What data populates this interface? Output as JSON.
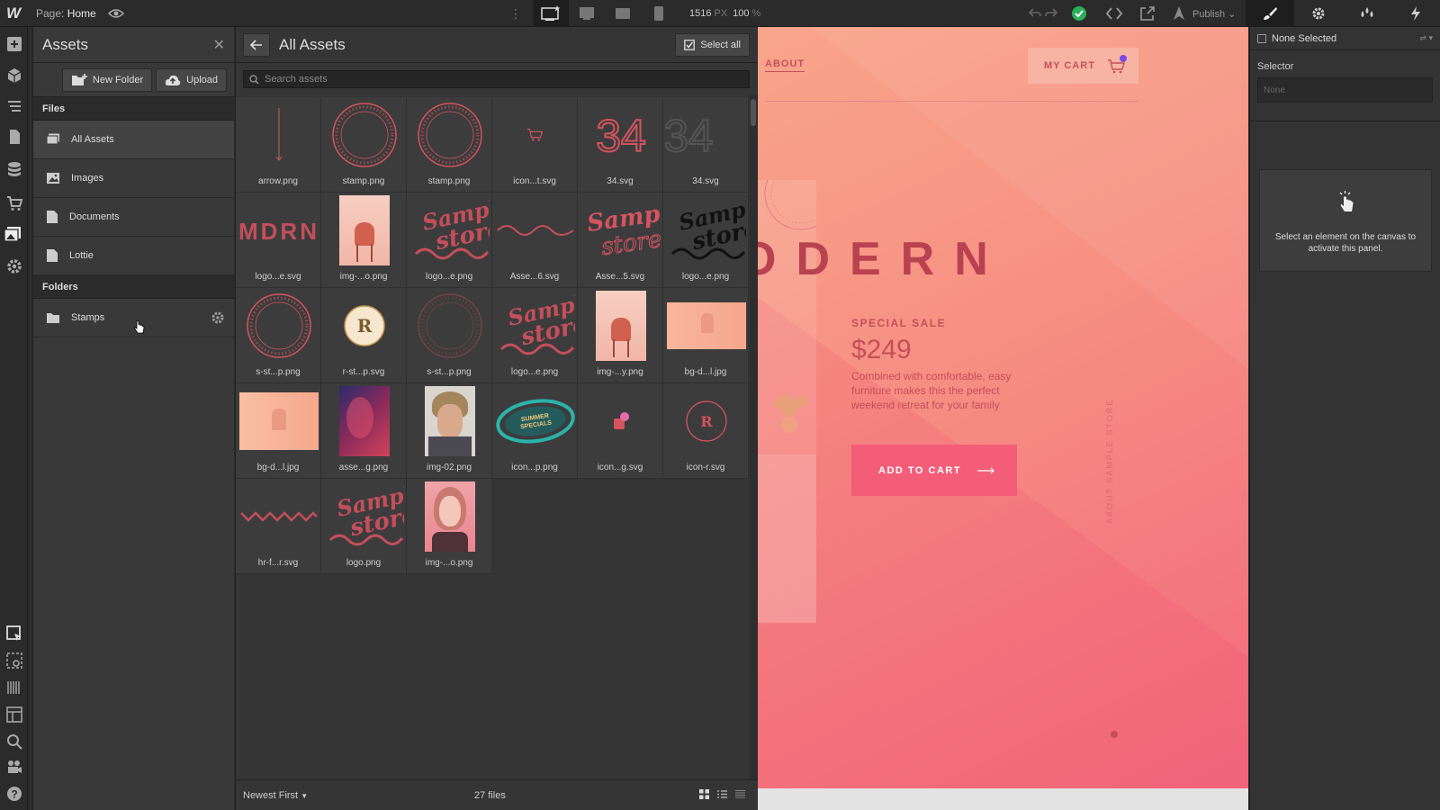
{
  "topbar": {
    "logo": "W",
    "page_label": "Page:",
    "page_name": "Home",
    "width_value": "1516",
    "width_unit": "PX",
    "zoom_value": "100",
    "zoom_unit": "%",
    "publish_label": "Publish"
  },
  "assets_panel": {
    "title": "Assets",
    "new_folder_label": "New Folder",
    "upload_label": "Upload",
    "files_section_label": "Files",
    "file_items": [
      {
        "label": "All Assets",
        "icon": "assets-icon",
        "active": true
      },
      {
        "label": "Images",
        "icon": "image-icon"
      },
      {
        "label": "Documents",
        "icon": "document-icon"
      },
      {
        "label": "Lottie",
        "icon": "document-icon"
      }
    ],
    "folders_section_label": "Folders",
    "folders": [
      {
        "label": "Stamps",
        "icon": "folder-icon"
      }
    ]
  },
  "asset_grid": {
    "title": "All Assets",
    "select_all_label": "Select all",
    "search_placeholder": "Search assets",
    "sort_label": "Newest First",
    "file_count": "27 files",
    "tiles": [
      {
        "label": "arrow.png",
        "kind": "arrow"
      },
      {
        "label": "stamp.png",
        "kind": "stamp"
      },
      {
        "label": "stamp.png",
        "kind": "stamp"
      },
      {
        "label": "icon...t.svg",
        "kind": "cart"
      },
      {
        "label": "34.svg",
        "kind": "num34",
        "thumb_text": "34"
      },
      {
        "label": "34.svg",
        "kind": "num34dim",
        "thumb_text": "34"
      },
      {
        "label": "logo...e.svg",
        "kind": "mdrn",
        "thumb_text": "MDRN"
      },
      {
        "label": "img-...o.png",
        "kind": "chair"
      },
      {
        "label": "logo...e.png",
        "kind": "sample",
        "thumb_text": "Sample store"
      },
      {
        "label": "Asse...6.svg",
        "kind": "wave"
      },
      {
        "label": "Asse...5.svg",
        "kind": "sample2",
        "thumb_text": "Sample store"
      },
      {
        "label": "logo...e.png",
        "kind": "sampleblack",
        "thumb_text": "Sample store"
      },
      {
        "label": "s-st...p.png",
        "kind": "stamp"
      },
      {
        "label": "r-st...p.svg",
        "kind": "rcircle",
        "thumb_text": "R"
      },
      {
        "label": "s-st...p.png",
        "kind": "stampdim"
      },
      {
        "label": "logo...e.png",
        "kind": "sample",
        "thumb_text": "Sample store"
      },
      {
        "label": "img-...y.png",
        "kind": "chair"
      },
      {
        "label": "bg-d...l.jpg",
        "kind": "bgwide"
      },
      {
        "label": "bg-d...l.jpg",
        "kind": "bg"
      },
      {
        "label": "asse...g.png",
        "kind": "face"
      },
      {
        "label": "img-02.png",
        "kind": "portrait"
      },
      {
        "label": "icon...p.png",
        "kind": "summer",
        "thumb_text": "SUMMER SPECIALS"
      },
      {
        "label": "icon...g.svg",
        "kind": "bag"
      },
      {
        "label": "icon-r.svg",
        "kind": "ricon",
        "thumb_text": "R"
      },
      {
        "label": "hr-f...r.svg",
        "kind": "zigzag"
      },
      {
        "label": "logo.png",
        "kind": "sample",
        "thumb_text": "Sample store"
      },
      {
        "label": "img-...o.png",
        "kind": "woman"
      }
    ]
  },
  "canvas": {
    "nav_about": "ABOUT",
    "cart_label": "MY CART",
    "heading": "ODERN",
    "special_sale": "SPECIAL SALE",
    "price": "$249",
    "description": "Combined with comfortable, easy furniture makes this the perfect weekend retreat for your family",
    "cta": "ADD TO CART",
    "vertical_text": "ABOUT SAMPLE STORE",
    "accent": "#f35d78",
    "text_color": "#c44f5b"
  },
  "right_panel": {
    "none_selected": "None Selected",
    "selector_label": "Selector",
    "selector_placeholder": "None",
    "empty_message": "Select an element on the canvas to activate this panel."
  }
}
